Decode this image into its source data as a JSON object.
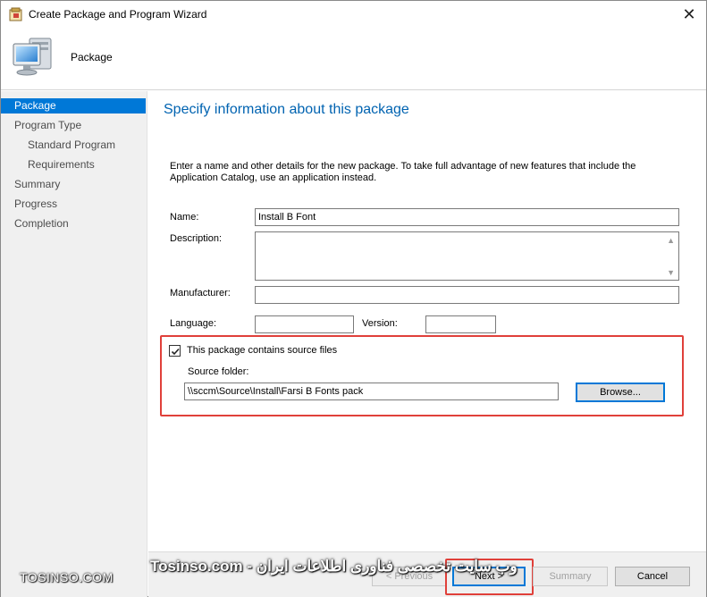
{
  "window": {
    "title": "Create Package and Program Wizard",
    "close_glyph": "✕"
  },
  "header": {
    "title": "Package",
    "icon": "computer-monitor-icon"
  },
  "sidebar": {
    "items": [
      {
        "label": "Package",
        "active": true
      },
      {
        "label": "Program Type",
        "active": false
      },
      {
        "label": "Standard Program",
        "active": false
      },
      {
        "label": "Requirements",
        "active": false
      },
      {
        "label": "Summary",
        "active": false
      },
      {
        "label": "Progress",
        "active": false
      },
      {
        "label": "Completion",
        "active": false
      }
    ]
  },
  "main": {
    "heading": "Specify information about this package",
    "intro": "Enter a name and other details for the new package. To take full advantage of new features that include the Application Catalog, use an application instead.",
    "fields": {
      "name_label": "Name:",
      "name_value": "Install B Font",
      "description_label": "Description:",
      "description_value": "",
      "manufacturer_label": "Manufacturer:",
      "manufacturer_value": "",
      "language_label": "Language:",
      "language_value": "",
      "version_label": "Version:",
      "version_value": ""
    },
    "source": {
      "checkbox_label": "This package contains source files",
      "checked": true,
      "folder_label": "Source folder:",
      "folder_value": "\\\\sccm\\Source\\Install\\Farsi B Fonts pack",
      "browse_label": "Browse..."
    }
  },
  "footer": {
    "previous_label": "< Previous",
    "next_label": "Next >",
    "summary_label": "Summary",
    "cancel_label": "Cancel"
  },
  "watermark": {
    "left": "TOSINSO.COM",
    "right": "وب سایت تخصصی فناوری اطلاعات ایران - Tosinso.com"
  },
  "colors": {
    "accent": "#0078d7",
    "heading": "#0063b1",
    "highlight": "#e0403a"
  }
}
